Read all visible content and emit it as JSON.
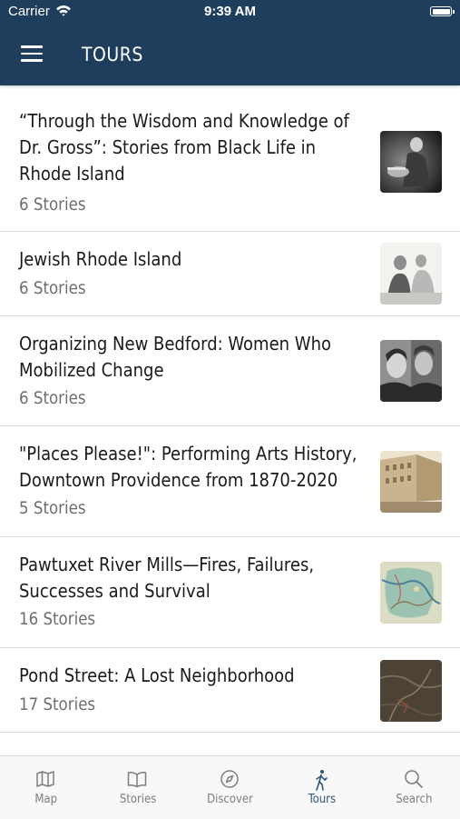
{
  "status_bar": {
    "carrier": "Carrier",
    "time": "9:39 AM"
  },
  "nav": {
    "title": "TOURS",
    "menu_icon": "hamburger-menu-icon"
  },
  "tours": [
    {
      "title": "“Through the Wisdom and Knowledge of Dr. Gross”: Stories from Black Life in Rhode Island",
      "count": "6 Stories",
      "thumb": "dark-photo"
    },
    {
      "title": "Jewish Rhode Island",
      "count": "6 Stories",
      "thumb": "children-photo"
    },
    {
      "title": "Organizing New Bedford: Women Who Mobilized Change",
      "count": "6 Stories",
      "thumb": "women-photo"
    },
    {
      "title": "\"Places Please!\": Performing Arts History, Downtown Providence from 1870-2020",
      "count": "5 Stories",
      "thumb": "theater-photo"
    },
    {
      "title": "Pawtuxet River Mills—Fires, Failures, Successes and Survival",
      "count": "16 Stories",
      "thumb": "map-photo"
    },
    {
      "title": "Pond Street: A Lost Neighborhood",
      "count": "17 Stories",
      "thumb": "dark-map-photo"
    }
  ],
  "tabs": [
    {
      "label": "Map",
      "icon": "map-icon",
      "active": false
    },
    {
      "label": "Stories",
      "icon": "book-icon",
      "active": false
    },
    {
      "label": "Discover",
      "icon": "compass-icon",
      "active": false
    },
    {
      "label": "Tours",
      "icon": "walking-person-icon",
      "active": true
    },
    {
      "label": "Search",
      "icon": "search-icon",
      "active": false
    }
  ],
  "colors": {
    "nav_bg": "#1f3d5c",
    "tab_active": "#2e5680",
    "tab_inactive": "#7d7d7d"
  }
}
